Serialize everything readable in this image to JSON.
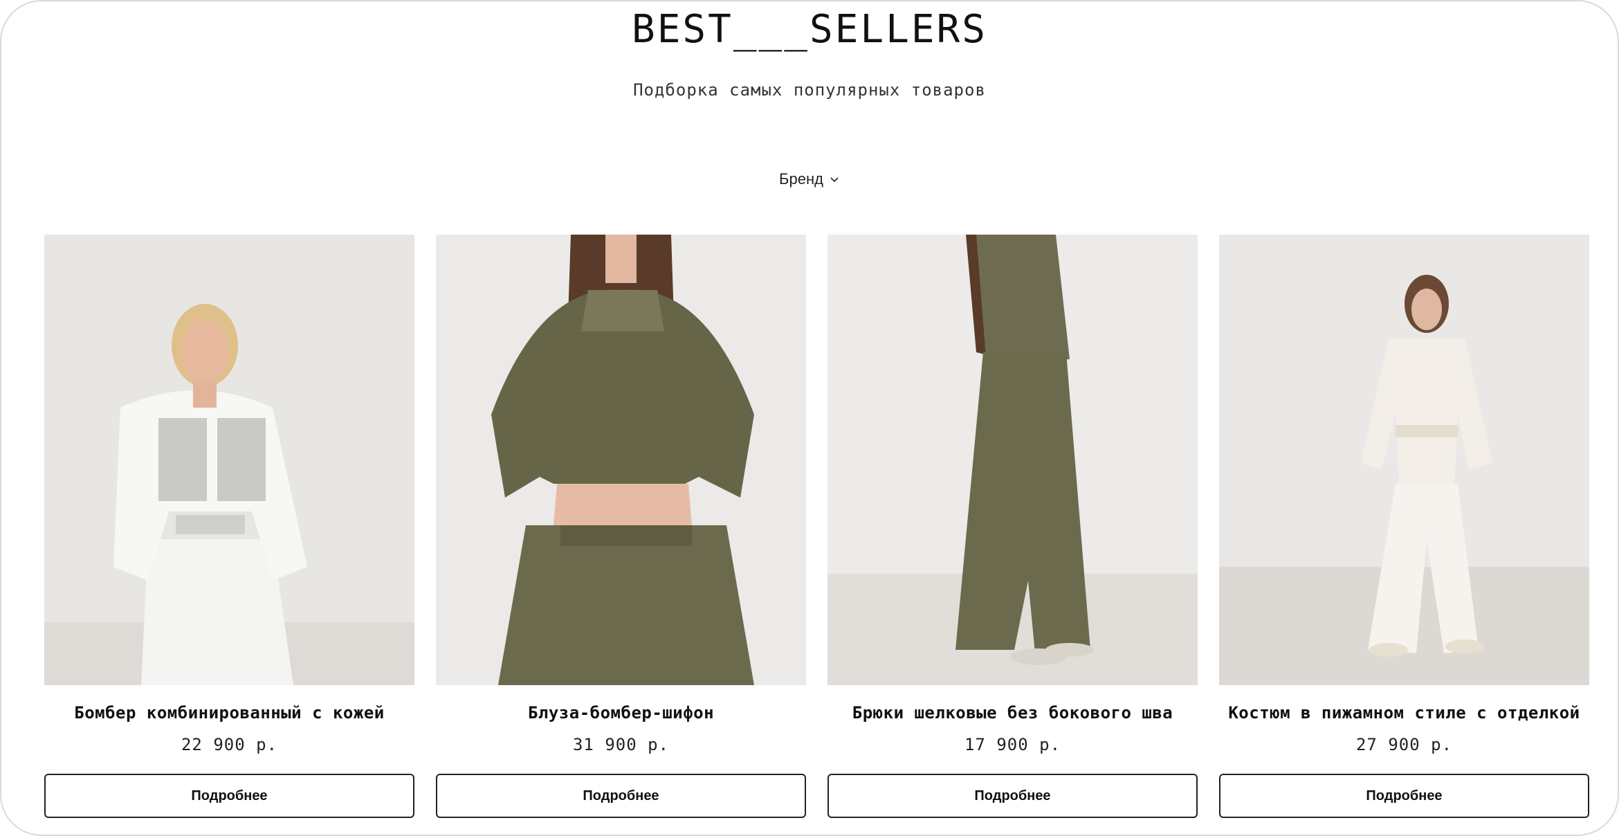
{
  "header": {
    "title": "BEST___SELLERS",
    "subtitle": "Подборка самых популярных товаров"
  },
  "filter": {
    "label": "Бренд",
    "icon": "chevron-down-icon"
  },
  "products": [
    {
      "name": "Бомбер комбинированный с кожей",
      "price": "22 900 р.",
      "button_label": "Подробнее",
      "image_alt": "Model in white bomber and white pants"
    },
    {
      "name": "Блуза-бомбер-шифон",
      "price": "31 900 р.",
      "button_label": "Подробнее",
      "image_alt": "Model in olive chiffon blouse and olive trousers"
    },
    {
      "name": "Брюки шелковые без бокового шва",
      "price": "17 900 р.",
      "button_label": "Подробнее",
      "image_alt": "Model in olive silk wide trousers, side view"
    },
    {
      "name": "Костюм в пижамном стиле с отделкой",
      "price": "27 900 р.",
      "button_label": "Подробнее",
      "image_alt": "Model in white pajama-style suit"
    }
  ],
  "colors": {
    "text": "#111111",
    "border": "#222222",
    "olive": "#6b6a4c",
    "cream": "#efebe3",
    "background": "#ffffff"
  }
}
